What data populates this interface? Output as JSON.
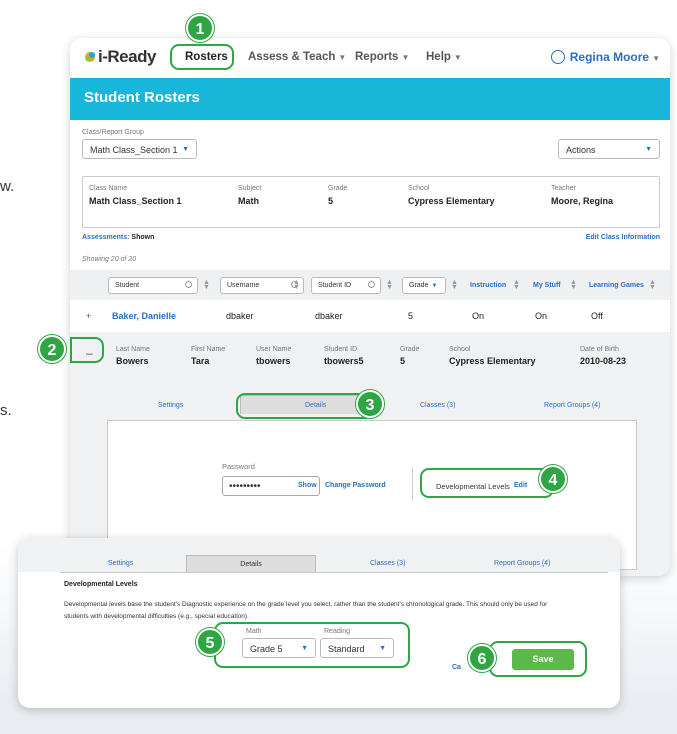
{
  "background": {
    "fragment_top": "w.",
    "fragment_bottom": "s."
  },
  "nav": {
    "logo": "i-Ready",
    "items": [
      {
        "label": "Rosters"
      },
      {
        "label": "Assess & Teach"
      },
      {
        "label": "Reports"
      },
      {
        "label": "Help"
      }
    ],
    "user": "Regina Moore"
  },
  "page_title": "Student Rosters",
  "class_group": {
    "label": "Class/Report Group",
    "value": "Math Class_Section 1"
  },
  "actions": {
    "label": "Actions"
  },
  "class_info": {
    "fields": [
      {
        "label": "Class Name",
        "value": "Math Class_Section 1"
      },
      {
        "label": "Subject",
        "value": "Math"
      },
      {
        "label": "Grade",
        "value": "5"
      },
      {
        "label": "School",
        "value": "Cypress Elementary"
      },
      {
        "label": "Teacher",
        "value": "Moore, Regina"
      }
    ]
  },
  "assessments": {
    "label": "Assessments:",
    "value": "Shown"
  },
  "edit_class_info": "Edit Class Information",
  "showing": "Showing 20 of 20",
  "filters": {
    "student": "Student",
    "username": "Username",
    "student_id": "Student ID",
    "grade": "Grade",
    "instruction": "Instruction",
    "my_stuff": "My Stuff",
    "learning_games": "Learning Games"
  },
  "row1": {
    "expand": "+",
    "name": "Baker, Danielle",
    "first": "dbaker",
    "user": "dbaker",
    "grade": "5",
    "instruction": "On",
    "my_stuff": "On",
    "games": "Off"
  },
  "detail": {
    "collapse": "–",
    "fields": [
      {
        "label": "Last Name",
        "value": "Bowers"
      },
      {
        "label": "First Name",
        "value": "Tara"
      },
      {
        "label": "User Name",
        "value": "tbowers"
      },
      {
        "label": "Student ID",
        "value": "tbowers5"
      },
      {
        "label": "Grade",
        "value": "5"
      },
      {
        "label": "School",
        "value": "Cypress Elementary"
      },
      {
        "label": "Date of Birth",
        "value": "2010-08-23"
      }
    ]
  },
  "tabs": {
    "settings": "Settings",
    "details": "Details",
    "classes": "Classes (3)",
    "report_groups": "Report Groups (4)"
  },
  "password": {
    "label": "Password",
    "value": "•••••••••",
    "show": "Show",
    "change": "Change Password"
  },
  "dev_levels": {
    "label": "Developmental Levels",
    "edit": "Edit"
  },
  "dev_panel": {
    "title": "Developmental Levels",
    "text": "Developmental levels base the student's Diagnostic experience on the grade level you select, rather than the student's chronological grade. This should only be used for students with developmental difficulties (e.g., special education).",
    "math_label": "Math",
    "math_value": "Grade 5",
    "reading_label": "Reading",
    "reading_value": "Standard",
    "cancel": "Ca",
    "save": "Save"
  },
  "callouts": [
    "1",
    "2",
    "3",
    "4",
    "5",
    "6"
  ],
  "colors": {
    "accent": "#18b6d8",
    "highlight": "#2fa543",
    "link": "#2a6fc0",
    "save": "#5cb84a"
  }
}
